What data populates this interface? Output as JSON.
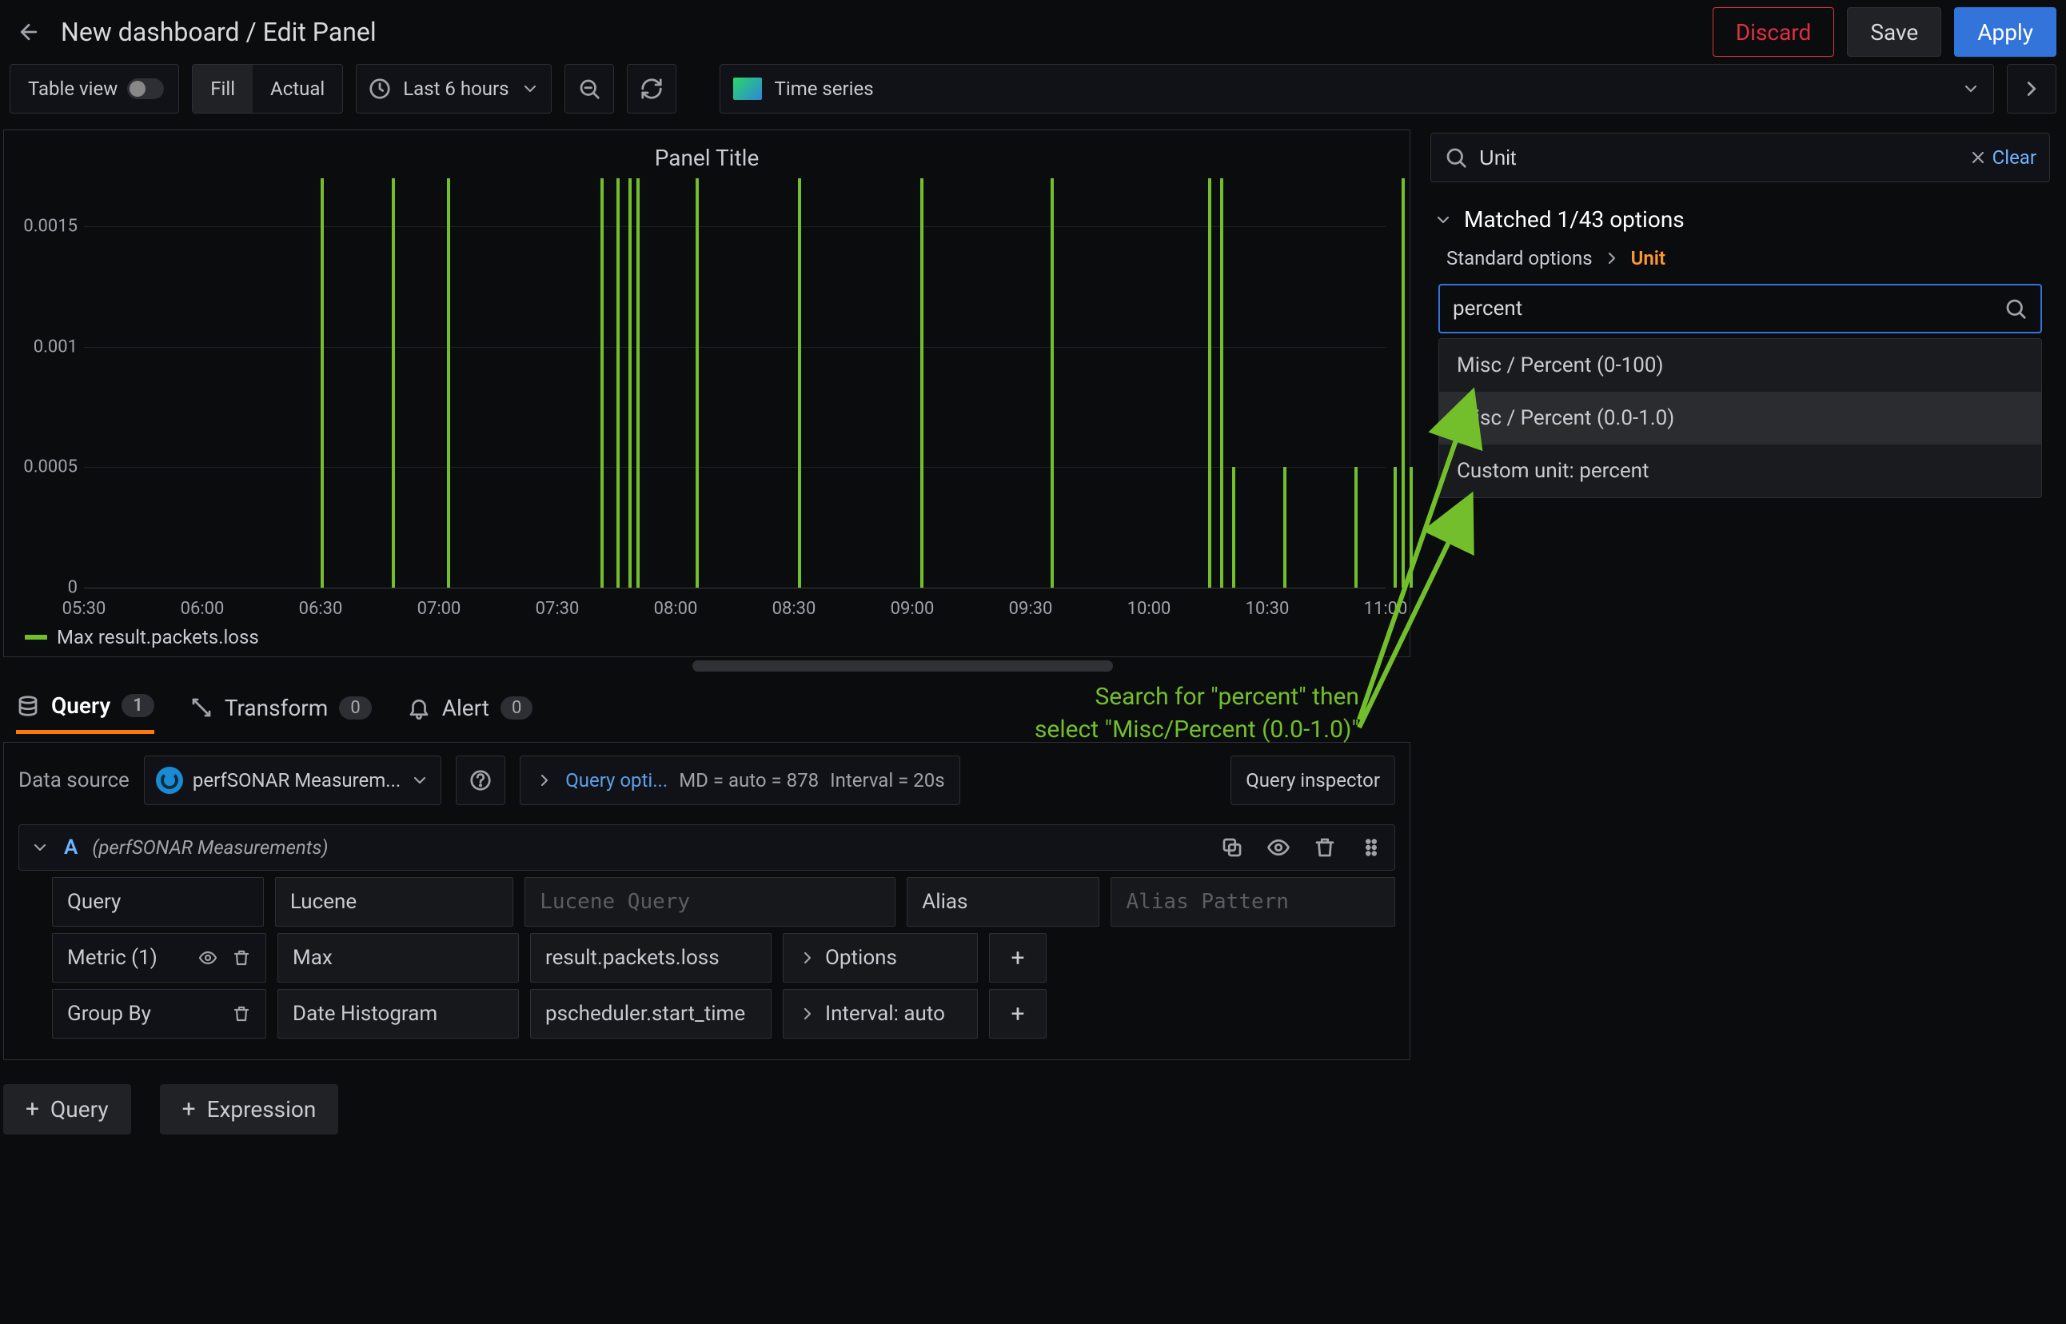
{
  "header": {
    "title": "New dashboard / Edit Panel",
    "discard": "Discard",
    "save": "Save",
    "apply": "Apply"
  },
  "toolbar": {
    "table_view": "Table view",
    "fill": "Fill",
    "actual": "Actual",
    "timerange": "Last 6 hours",
    "vis_type": "Time series"
  },
  "panel": {
    "title": "Panel Title",
    "legend": "Max result.packets.loss"
  },
  "chart_data": {
    "type": "bar",
    "title": "Panel Title",
    "xlabel": "",
    "ylabel": "",
    "ylim": [
      0,
      0.0017
    ],
    "yticks": [
      0,
      0.0005,
      0.001,
      0.0015
    ],
    "categories": [
      "05:30",
      "06:00",
      "06:30",
      "07:00",
      "07:30",
      "08:00",
      "08:30",
      "09:00",
      "09:30",
      "10:00",
      "10:30",
      "11:00"
    ],
    "series": [
      {
        "name": "Max result.packets.loss",
        "color": "#73bf2b",
        "points": [
          {
            "x": "06:30",
            "y": 0.0017
          },
          {
            "x": "06:48",
            "y": 0.0017
          },
          {
            "x": "07:02",
            "y": 0.0017
          },
          {
            "x": "07:41",
            "y": 0.0017
          },
          {
            "x": "07:45",
            "y": 0.0017
          },
          {
            "x": "07:48",
            "y": 0.0017
          },
          {
            "x": "07:50",
            "y": 0.0017
          },
          {
            "x": "08:05",
            "y": 0.0017
          },
          {
            "x": "08:31",
            "y": 0.0017
          },
          {
            "x": "09:02",
            "y": 0.0017
          },
          {
            "x": "09:35",
            "y": 0.0017
          },
          {
            "x": "10:15",
            "y": 0.0017
          },
          {
            "x": "10:18",
            "y": 0.0017
          },
          {
            "x": "10:21",
            "y": 0.0005
          },
          {
            "x": "10:34",
            "y": 0.0005
          },
          {
            "x": "10:52",
            "y": 0.0005
          },
          {
            "x": "11:02",
            "y": 0.0005
          },
          {
            "x": "11:04",
            "y": 0.0017
          },
          {
            "x": "11:06",
            "y": 0.0005
          }
        ]
      }
    ]
  },
  "tabs": {
    "query": "Query",
    "query_count": "1",
    "transform": "Transform",
    "transform_count": "0",
    "alert": "Alert",
    "alert_count": "0"
  },
  "query": {
    "data_source_label": "Data source",
    "data_source_name": "perfSONAR Measurem...",
    "query_options_link": "Query opti...",
    "md": "MD = auto = 878",
    "interval": "Interval = 20s",
    "inspector": "Query inspector",
    "letter": "A",
    "ds_full": "(perfSONAR Measurements)",
    "row_query_label": "Query",
    "row_query_type": "Lucene",
    "row_query_placeholder": "Lucene Query",
    "row_alias_label": "Alias",
    "row_alias_placeholder": "Alias Pattern",
    "row_metric_label": "Metric (1)",
    "row_metric_agg": "Max",
    "row_metric_field": "result.packets.loss",
    "row_metric_options": "Options",
    "row_groupby_label": "Group By",
    "row_groupby_agg": "Date Histogram",
    "row_groupby_field": "pscheduler.start_time",
    "row_groupby_interval": "Interval: auto",
    "add_query": "Query",
    "add_expression": "Expression"
  },
  "side": {
    "search_value": "Unit",
    "clear": "Clear",
    "matched": "Matched 1/43 options",
    "breadcrumb_group": "Standard options",
    "breadcrumb_leaf": "Unit",
    "unit_input": "percent",
    "options": [
      "Misc / Percent (0-100)",
      "Misc / Percent (0.0-1.0)",
      "Custom unit: percent"
    ]
  },
  "annotation": {
    "line1": "Search for \"percent\" then",
    "line2": "select \"Misc/Percent (0.0-1.0)\""
  }
}
